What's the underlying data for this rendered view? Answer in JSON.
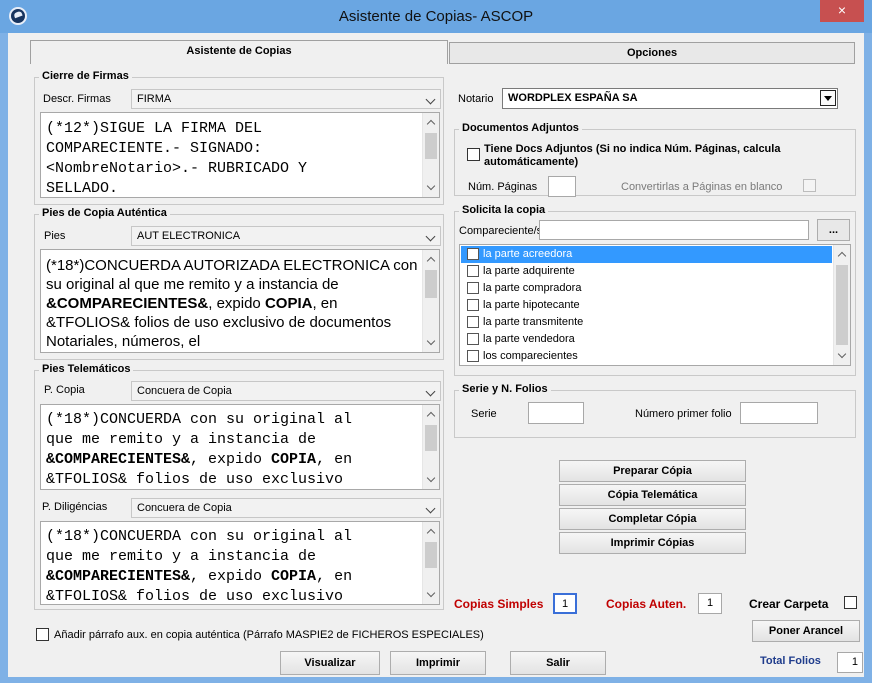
{
  "window": {
    "title": "Asistente de Copias- ASCOP",
    "close_glyph": "×"
  },
  "tabs": [
    {
      "label": "Asistente de Copias",
      "active": true
    },
    {
      "label": "Opciones",
      "active": false
    }
  ],
  "cierre_firmas": {
    "title": "Cierre de Firmas",
    "descr_label": "Descr. Firmas",
    "descr_value": "FIRMA",
    "text": "(*12*)SIGUE LA FIRMA DEL\nCOMPARECIENTE.- SIGNADO:\n<NombreNotario>.- RUBRICADO Y\nSELLADO."
  },
  "pies_autentica": {
    "title": "Pies de Copia Auténtica",
    "pies_label": "Pies",
    "pies_value": "AUT ELECTRONICA",
    "text_parts": {
      "p1": "(*18*)CONCUERDA AUTORIZADA ELECTRONICA con su original al que me remito y a instancia de ",
      "b1": "&COMPARECIENTES&",
      "p2": ", expido ",
      "b2": "COPIA",
      "p3": ", en &TFOLIOS& folios de uso exclusivo de documentos Notariales, números, el"
    }
  },
  "pies_telematicos": {
    "title": "Pies Telemáticos",
    "pcopia_label": "P. Copia",
    "pcopia_value": "Concuera de Copia",
    "pcopia_text": {
      "l1": "(*18*)CONCUERDA con su original al",
      "l2": "que me remito y a instancia de",
      "l3b": "&COMPARECIENTES&",
      "l3": ", expido ",
      "l3b2": "COPIA",
      "l3e": ", en",
      "l4": "&TFOLIOS& folios de uso exclusivo"
    },
    "pdilig_label": "P. Diligéncias",
    "pdilig_value": "Concuera de Copia",
    "pdilig_text": {
      "l1": "(*18*)CONCUERDA con su original al",
      "l2": "que me remito y a instancia de",
      "l3b": "&COMPARECIENTES&",
      "l3": ", expido ",
      "l3b2": "COPIA",
      "l3e": ", en",
      "l4": "&TFOLIOS& folios de uso exclusivo"
    }
  },
  "aux_checkbox_label": "Añadir párrafo aux. en copia auténtica (Párrafo MASPIE2 de FICHEROS ESPECIALES)",
  "notario": {
    "label": "Notario",
    "value": "WORDPLEX ESPAÑA SA"
  },
  "docs_adjuntos": {
    "title": "Documentos Adjuntos",
    "tiene_label_l1": "Tiene Docs Adjuntos (Si no indica Núm. Páginas, calcula",
    "tiene_label_l2": "automáticamente)",
    "num_paginas_label": "Núm. Páginas",
    "convertir_label": "Convertirlas a Páginas en blanco"
  },
  "solicita": {
    "title": "Solicita la copia",
    "comparecientes_label": "Compareciente/s",
    "browse_label": "...",
    "items": [
      "la parte acreedora",
      "la parte adquirente",
      "la parte compradora",
      "la parte hipotecante",
      "la parte transmitente",
      "la parte vendedora",
      "los comparecientes"
    ]
  },
  "serie": {
    "title": "Serie y N. Folios",
    "serie_label": "Serie",
    "numero_label": "Número primer folio"
  },
  "actions": {
    "preparar": "Preparar Cópia",
    "telematica": "Cópia Telemática",
    "completar": "Completar Cópia",
    "imprimir_copias": "Imprimir Cópias"
  },
  "copias": {
    "simples_label": "Copias Simples",
    "simples_value": "1",
    "auten_label": "Copias Auten.",
    "auten_value": "1",
    "carpeta_label": "Crear Carpeta",
    "arancel_label": "Poner Arancel"
  },
  "footer": {
    "visualizar": "Visualizar",
    "imprimir": "Imprimir",
    "salir": "Salir",
    "total_label": "Total Folios",
    "total_value": "1"
  },
  "colors": {
    "title_bar": "#6aa6e2",
    "close": "#c75050",
    "selection": "#3399ff",
    "red_label": "#c00000",
    "navy_label": "#1f3c8c"
  }
}
